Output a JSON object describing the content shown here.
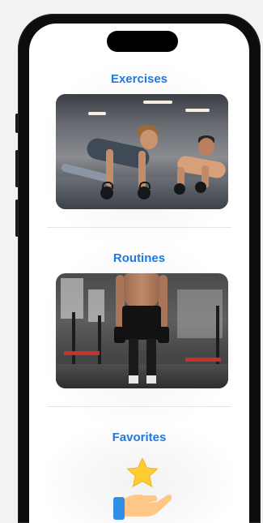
{
  "sections": {
    "exercises": {
      "title": "Exercises"
    },
    "routines": {
      "title": "Routines"
    },
    "favorites": {
      "title": "Favorites"
    }
  },
  "accent_color": "#1f7ae0",
  "icons": {
    "favorites": "hand-star-icon"
  }
}
